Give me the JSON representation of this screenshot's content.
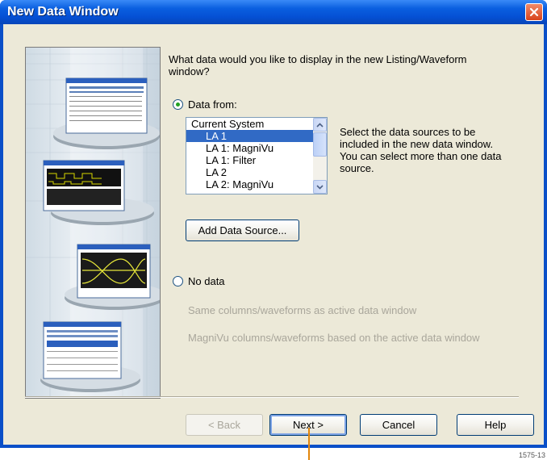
{
  "window": {
    "title": "New Data Window",
    "close_icon": "close-icon"
  },
  "content": {
    "question": "What data would you like to display in the new Listing/Waveform window?",
    "option_data_from": {
      "label": "Data from:",
      "selected": true
    },
    "data_sources": [
      {
        "label": "Current System",
        "indent": false,
        "selected": false
      },
      {
        "label": "LA 1",
        "indent": true,
        "selected": true
      },
      {
        "label": "LA 1: MagniVu",
        "indent": true,
        "selected": false
      },
      {
        "label": "LA 1: Filter",
        "indent": true,
        "selected": false
      },
      {
        "label": "LA 2",
        "indent": true,
        "selected": false
      },
      {
        "label": "LA 2: MagniVu",
        "indent": true,
        "selected": false
      }
    ],
    "help_text": "Select the data sources to be included in the new data window. You can select more than one data source.",
    "add_source_button": "Add Data Source...",
    "option_no_data": {
      "label": "No data",
      "selected": false
    },
    "no_data_option_1": "Same columns/waveforms as active data window",
    "no_data_option_2": "MagniVu columns/waveforms based on the active data window"
  },
  "buttons": {
    "back": "< Back",
    "next": "Next >",
    "cancel": "Cancel",
    "help": "Help"
  },
  "figure_id": "1575-13",
  "colors": {
    "title_bar": "#0550d4",
    "selection": "#316ac5",
    "callout_line": "#e3860c",
    "dialog_bg": "#ece9d8"
  }
}
